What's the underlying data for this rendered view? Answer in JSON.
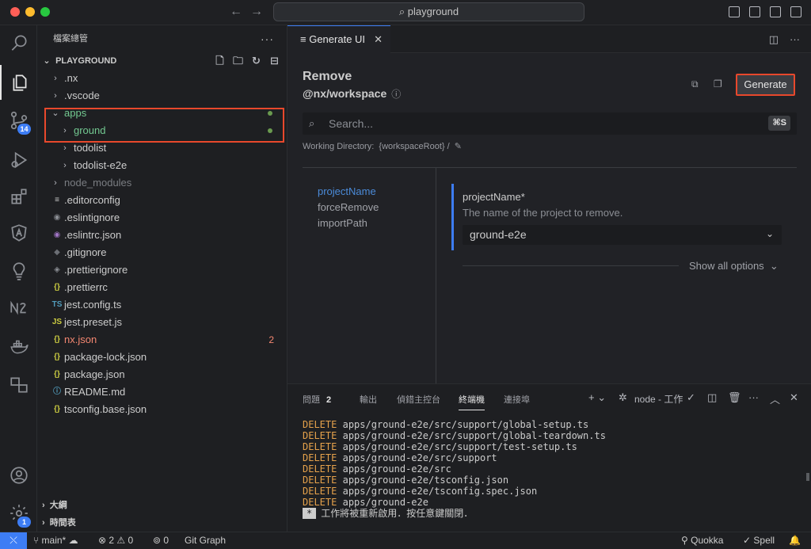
{
  "titlebar": {
    "search": "playground"
  },
  "activity": {
    "source_control_badge": "14",
    "accounts_badge": "1"
  },
  "sidebar": {
    "title": "檔案總管",
    "section": "PLAYGROUND",
    "tree": [
      {
        "label": ".nx",
        "type": "folder",
        "indent": 0
      },
      {
        "label": ".vscode",
        "type": "folder",
        "indent": 0
      },
      {
        "label": "apps",
        "type": "folder-open",
        "indent": 0,
        "state": "green",
        "dot": true
      },
      {
        "label": "ground",
        "type": "folder",
        "indent": 1,
        "state": "green",
        "dot": true
      },
      {
        "label": "todolist",
        "type": "folder",
        "indent": 1
      },
      {
        "label": "todolist-e2e",
        "type": "folder",
        "indent": 1
      },
      {
        "label": "node_modules",
        "type": "folder",
        "indent": 0,
        "state": "dim"
      },
      {
        "label": ".editorconfig",
        "type": "file",
        "icon": "≡",
        "iconColor": "#cccccc"
      },
      {
        "label": ".eslintignore",
        "type": "file",
        "icon": "◉",
        "iconColor": "#8b8e94"
      },
      {
        "label": ".eslintrc.json",
        "type": "file",
        "icon": "◉",
        "iconColor": "#a074c4"
      },
      {
        "label": ".gitignore",
        "type": "file",
        "icon": "◆",
        "iconColor": "#6b6e74"
      },
      {
        "label": ".prettierignore",
        "type": "file",
        "icon": "◈",
        "iconColor": "#8b8e94"
      },
      {
        "label": ".prettierrc",
        "type": "file",
        "icon": "{}",
        "iconColor": "#cbcb41"
      },
      {
        "label": "jest.config.ts",
        "type": "file",
        "icon": "TS",
        "iconColor": "#519aba"
      },
      {
        "label": "jest.preset.js",
        "type": "file",
        "icon": "JS",
        "iconColor": "#cbcb41"
      },
      {
        "label": "nx.json",
        "type": "file",
        "icon": "{}",
        "iconColor": "#cbcb41",
        "state": "red",
        "count": "2"
      },
      {
        "label": "package-lock.json",
        "type": "file",
        "icon": "{}",
        "iconColor": "#cbcb41"
      },
      {
        "label": "package.json",
        "type": "file",
        "icon": "{}",
        "iconColor": "#cbcb41"
      },
      {
        "label": "README.md",
        "type": "file",
        "icon": "ⓘ",
        "iconColor": "#519aba"
      },
      {
        "label": "tsconfig.base.json",
        "type": "file",
        "icon": "{}",
        "iconColor": "#cbcb41"
      }
    ],
    "outline": "大綱",
    "timeline": "時間表"
  },
  "editor": {
    "tab_label": "Generate UI",
    "title": "Remove",
    "subtitle": "@nx/workspace",
    "generate_label": "Generate",
    "search_placeholder": "Search...",
    "search_shortcut": "⌘S",
    "working_dir_label": "Working Directory:",
    "working_dir_value": "{workspaceRoot} /",
    "options": [
      "projectName",
      "forceRemove",
      "importPath"
    ],
    "field_label": "projectName*",
    "field_desc": "The name of the project to remove.",
    "field_value": "ground-e2e",
    "show_all": "Show all options"
  },
  "panel": {
    "tabs": [
      {
        "label": "問題",
        "badge": "2"
      },
      {
        "label": "輸出"
      },
      {
        "label": "偵錯主控台"
      },
      {
        "label": "終端機",
        "active": true
      },
      {
        "label": "連接埠"
      }
    ],
    "terminal_name": "node - 工作",
    "lines": [
      {
        "kw": "DELETE",
        "path": "apps/ground-e2e/src/support/global-setup.ts"
      },
      {
        "kw": "DELETE",
        "path": "apps/ground-e2e/src/support/global-teardown.ts"
      },
      {
        "kw": "DELETE",
        "path": "apps/ground-e2e/src/support/test-setup.ts"
      },
      {
        "kw": "DELETE",
        "path": "apps/ground-e2e/src/support"
      },
      {
        "kw": "DELETE",
        "path": "apps/ground-e2e/src"
      },
      {
        "kw": "DELETE",
        "path": "apps/ground-e2e/tsconfig.json"
      },
      {
        "kw": "DELETE",
        "path": "apps/ground-e2e/tsconfig.spec.json"
      },
      {
        "kw": "DELETE",
        "path": "apps/ground-e2e"
      }
    ],
    "cursor_mark": "*",
    "cursor_text": "工作將被重新啟用．按任意鍵關閉．"
  },
  "statusbar": {
    "branch": "main*",
    "errors": "2",
    "warnings": "0",
    "ports": "0",
    "git_graph": "Git Graph",
    "quokka": "Quokka",
    "spell": "Spell"
  }
}
